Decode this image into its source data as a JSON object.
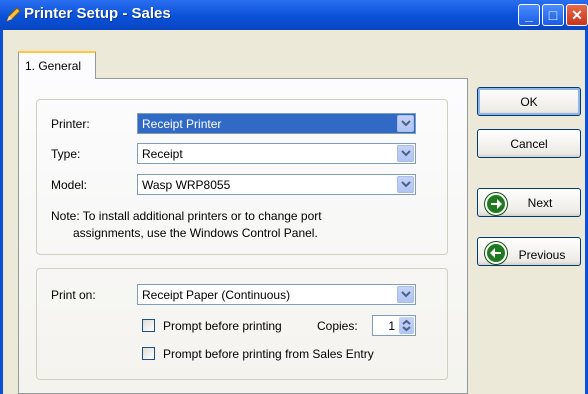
{
  "window": {
    "title": "Printer Setup - Sales"
  },
  "tabs": [
    {
      "label": "1. General"
    }
  ],
  "printer_section": {
    "printer_label": "Printer:",
    "printer_value": "Receipt Printer",
    "type_label": "Type:",
    "type_value": "Receipt",
    "model_label": "Model:",
    "model_value": "Wasp WRP8055",
    "note_line1": "Note: To install additional printers or to change port",
    "note_line2": "assignments, use the Windows Control Panel."
  },
  "print_section": {
    "print_on_label": "Print on:",
    "print_on_value": "Receipt Paper (Continuous)",
    "prompt_label": "Prompt before printing",
    "copies_label": "Copies:",
    "copies_value": "1",
    "prompt_sales_label": "Prompt before printing from Sales Entry"
  },
  "buttons": {
    "ok": "OK",
    "cancel": "Cancel",
    "next": "Next",
    "previous": "Previous"
  },
  "colors": {
    "title_bar": "#0a50d8",
    "selection": "#316ac5",
    "nav_icon": "#1f7a1f"
  }
}
